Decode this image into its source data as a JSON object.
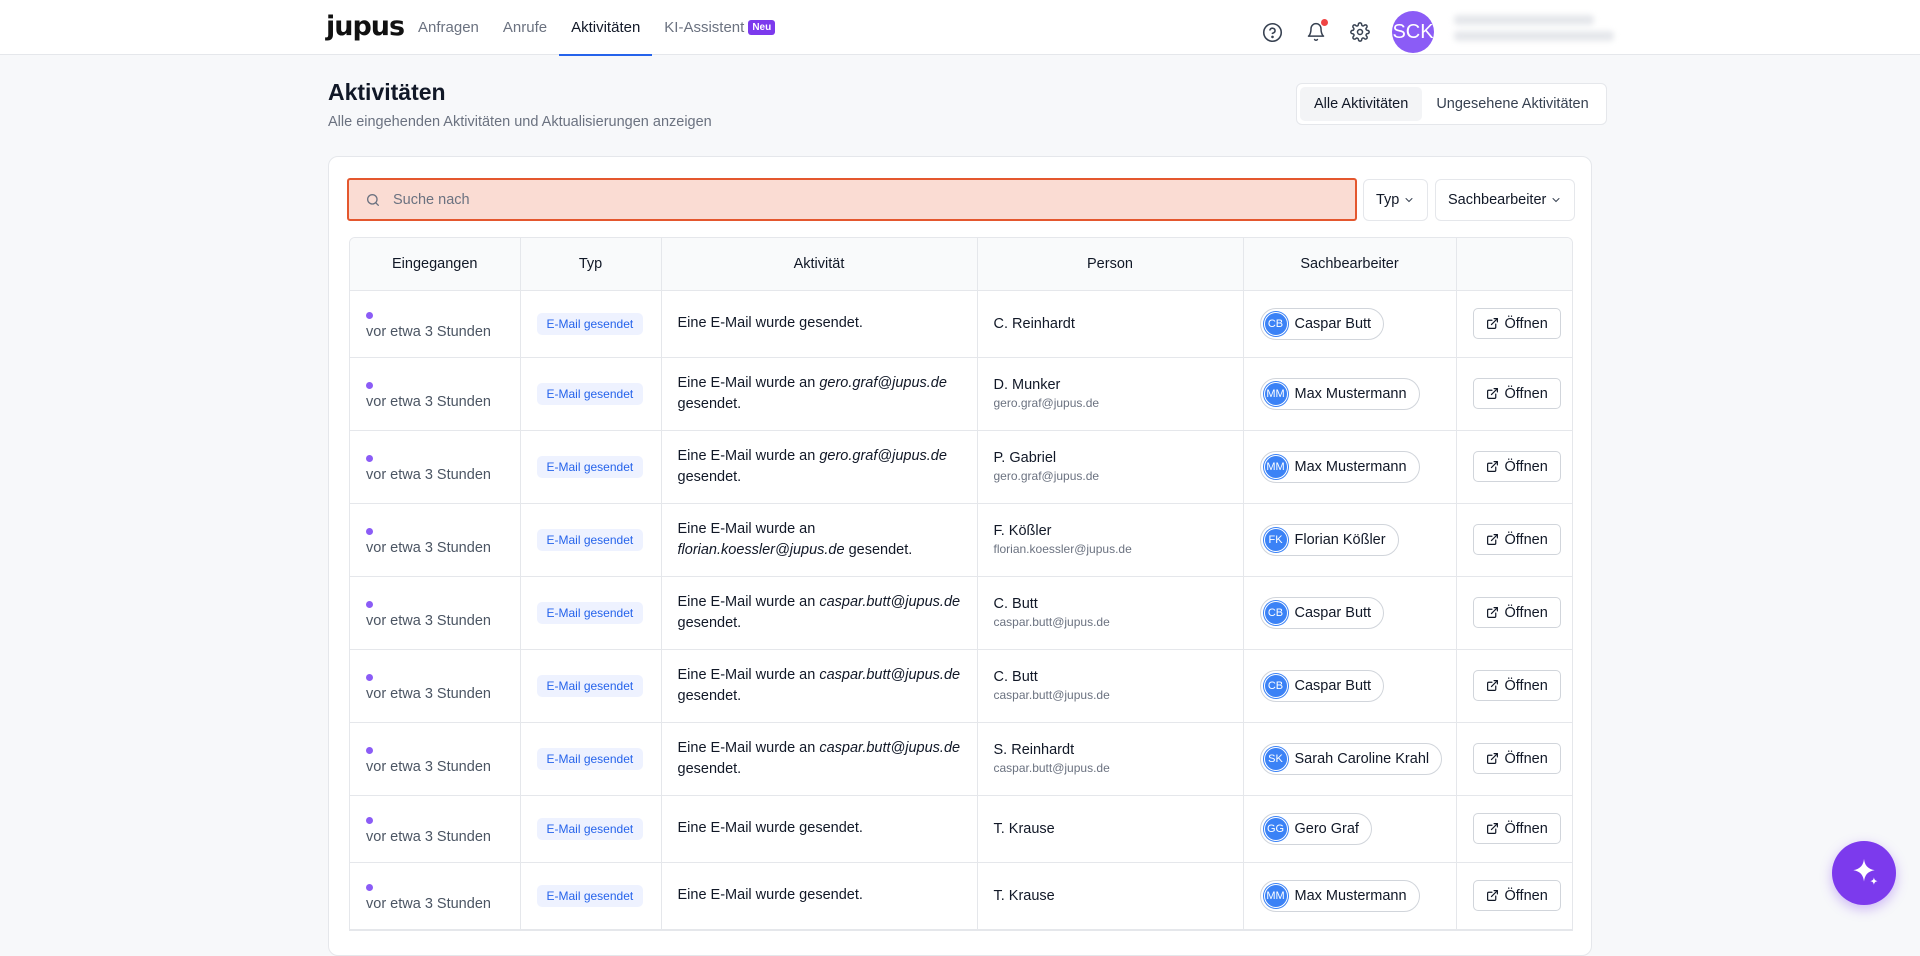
{
  "header": {
    "logo": "jupus",
    "nav": [
      {
        "label": "Anfragen",
        "active": false
      },
      {
        "label": "Anrufe",
        "active": false
      },
      {
        "label": "Aktivitäten",
        "active": true
      },
      {
        "label": "KI-Assistent",
        "active": false,
        "badge": "Neu"
      }
    ],
    "avatar_initials": "SCK",
    "icons": [
      "help-circle-icon",
      "bell-icon",
      "gear-icon"
    ]
  },
  "page": {
    "title": "Aktivitäten",
    "subtitle": "Alle eingehenden Aktivitäten und Aktualisierungen anzeigen",
    "filters": [
      {
        "label": "Alle Aktivitäten",
        "active": true
      },
      {
        "label": "Ungesehene Aktivitäten",
        "active": false
      }
    ]
  },
  "toolbar": {
    "search_placeholder": "Suche nach",
    "type_dropdown": "Typ",
    "agent_dropdown": "Sachbearbeiter"
  },
  "table": {
    "columns": [
      "Eingegangen",
      "Typ",
      "Aktivität",
      "Person",
      "Sachbearbeiter",
      ""
    ],
    "open_label": "Öffnen",
    "rows": [
      {
        "received": "vor etwa 3 Stunden",
        "type": "E-Mail gesendet",
        "activity_pre": "Eine E-Mail wurde gesendet.",
        "activity_email": "",
        "activity_post": "",
        "person": "C. Reinhardt",
        "person_email": "",
        "agent_initials": "CB",
        "agent": "Caspar Butt"
      },
      {
        "received": "vor etwa 3 Stunden",
        "type": "E-Mail gesendet",
        "activity_pre": "Eine E-Mail wurde an ",
        "activity_email": "gero.graf@jupus.de",
        "activity_post": " gesendet.",
        "person": "D. Munker",
        "person_email": "gero.graf@jupus.de",
        "agent_initials": "MM",
        "agent": "Max Mustermann"
      },
      {
        "received": "vor etwa 3 Stunden",
        "type": "E-Mail gesendet",
        "activity_pre": "Eine E-Mail wurde an ",
        "activity_email": "gero.graf@jupus.de",
        "activity_post": " gesendet.",
        "person": "P. Gabriel",
        "person_email": "gero.graf@jupus.de",
        "agent_initials": "MM",
        "agent": "Max Mustermann"
      },
      {
        "received": "vor etwa 3 Stunden",
        "type": "E-Mail gesendet",
        "activity_pre": "Eine E-Mail wurde an ",
        "activity_email": "florian.koessler@jupus.de",
        "activity_post": " gesendet.",
        "person": "F. Kößler",
        "person_email": "florian.koessler@jupus.de",
        "agent_initials": "FK",
        "agent": "Florian Kößler"
      },
      {
        "received": "vor etwa 3 Stunden",
        "type": "E-Mail gesendet",
        "activity_pre": "Eine E-Mail wurde an ",
        "activity_email": "caspar.butt@jupus.de",
        "activity_post": " gesendet.",
        "person": "C. Butt",
        "person_email": "caspar.butt@jupus.de",
        "agent_initials": "CB",
        "agent": "Caspar Butt"
      },
      {
        "received": "vor etwa 3 Stunden",
        "type": "E-Mail gesendet",
        "activity_pre": "Eine E-Mail wurde an ",
        "activity_email": "caspar.butt@jupus.de",
        "activity_post": " gesendet.",
        "person": "C. Butt",
        "person_email": "caspar.butt@jupus.de",
        "agent_initials": "CB",
        "agent": "Caspar Butt"
      },
      {
        "received": "vor etwa 3 Stunden",
        "type": "E-Mail gesendet",
        "activity_pre": "Eine E-Mail wurde an ",
        "activity_email": "caspar.butt@jupus.de",
        "activity_post": " gesendet.",
        "person": "S. Reinhardt",
        "person_email": "caspar.butt@jupus.de",
        "agent_initials": "SK",
        "agent": "Sarah Caroline Krahl"
      },
      {
        "received": "vor etwa 3 Stunden",
        "type": "E-Mail gesendet",
        "activity_pre": "Eine E-Mail wurde gesendet.",
        "activity_email": "",
        "activity_post": "",
        "person": "T. Krause",
        "person_email": "",
        "agent_initials": "GG",
        "agent": "Gero Graf"
      },
      {
        "received": "vor etwa 3 Stunden",
        "type": "E-Mail gesendet",
        "activity_pre": "Eine E-Mail wurde gesendet.",
        "activity_email": "",
        "activity_post": "",
        "person": "T. Krause",
        "person_email": "",
        "agent_initials": "MM",
        "agent": "Max Mustermann"
      }
    ]
  },
  "colors": {
    "accent": "#2563eb",
    "brand_purple": "#7c3aed",
    "search_bg": "#fadcd3",
    "search_border": "#e4572e"
  }
}
